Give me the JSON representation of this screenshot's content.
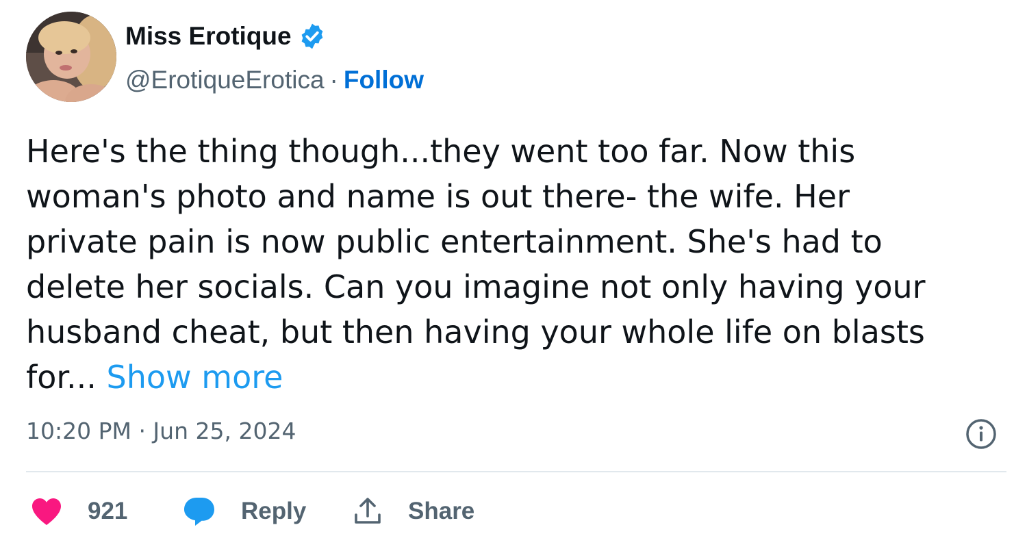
{
  "author": {
    "display_name": "Miss Erotique",
    "handle": "@ErotiqueErotica",
    "separator": "·",
    "follow_label": "Follow",
    "verified": true
  },
  "tweet": {
    "text_lines": [
      "Here's the thing though...they went too far. Now this",
      "woman's photo and name is out there- the wife. Her",
      "private pain is now public entertainment. She's had to",
      "delete her socials. Can you imagine not only having your",
      "husband cheat, but then having your whole life on blasts",
      "for..."
    ],
    "show_more_label": "Show more",
    "timestamp": "10:20 PM · Jun 25, 2024"
  },
  "actions": {
    "like_count": "921",
    "reply_label": "Reply",
    "share_label": "Share"
  },
  "icons": {
    "verified": "verified-badge-icon",
    "info": "info-icon",
    "like": "heart-icon",
    "reply": "speech-bubble-icon",
    "share": "upload-arrow-icon"
  },
  "colors": {
    "verified_blue": "#1d9bf0",
    "follow_blue": "#006fd6",
    "show_more_blue": "#1d9bf0",
    "like_pink": "#f91880",
    "secondary_text": "#536471",
    "primary_text": "#0f1419"
  }
}
